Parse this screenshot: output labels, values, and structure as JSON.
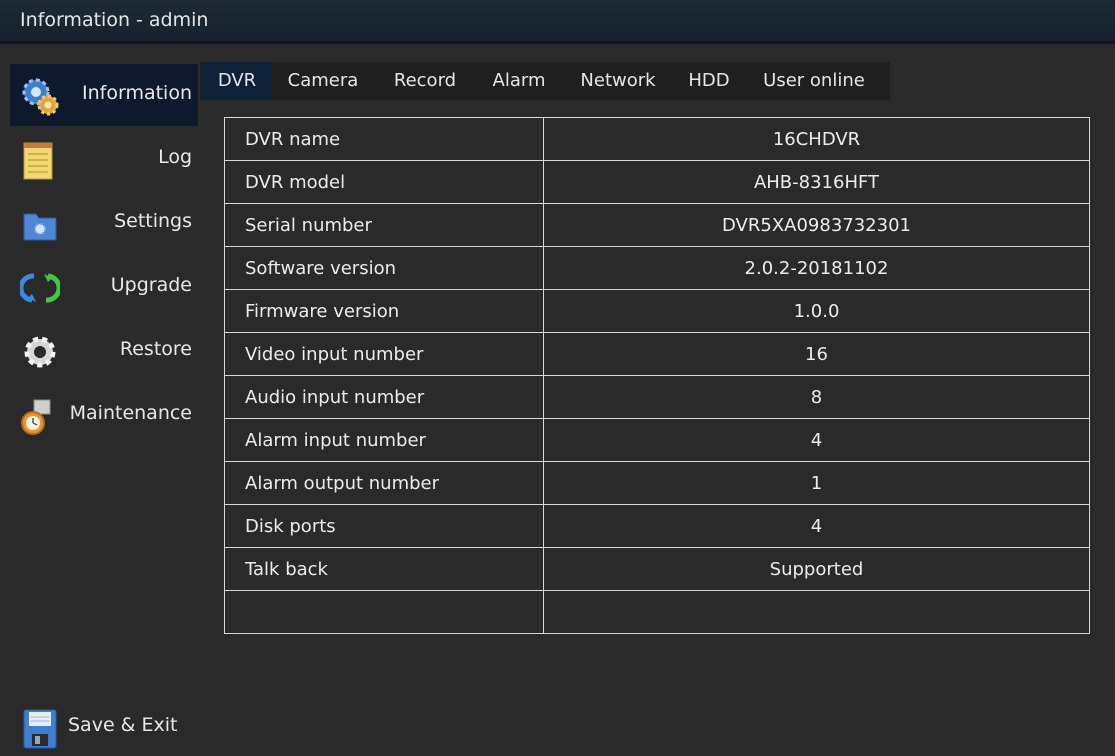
{
  "window": {
    "title": "Information - admin"
  },
  "sidebar": {
    "items": [
      {
        "label": "Information",
        "icon": "gears-icon",
        "active": true
      },
      {
        "label": "Log",
        "icon": "notepad-icon",
        "active": false
      },
      {
        "label": "Settings",
        "icon": "settings-folder-icon",
        "active": false
      },
      {
        "label": "Upgrade",
        "icon": "refresh-arrows-icon",
        "active": false
      },
      {
        "label": "Restore",
        "icon": "gear-icon",
        "active": false
      },
      {
        "label": "Maintenance",
        "icon": "clock-calendar-icon",
        "active": false
      }
    ],
    "save_exit": {
      "label": "Save & Exit",
      "icon": "floppy-disk-icon"
    }
  },
  "tabs": [
    {
      "label": "DVR",
      "active": true
    },
    {
      "label": "Camera",
      "active": false
    },
    {
      "label": "Record",
      "active": false
    },
    {
      "label": "Alarm",
      "active": false
    },
    {
      "label": "Network",
      "active": false
    },
    {
      "label": "HDD",
      "active": false
    },
    {
      "label": "User online",
      "active": false
    }
  ],
  "info_table": {
    "rows": [
      {
        "key": "DVR name",
        "value": "16CHDVR"
      },
      {
        "key": "DVR model",
        "value": "AHB-8316HFT"
      },
      {
        "key": "Serial number",
        "value": "DVR5XA0983732301"
      },
      {
        "key": "Software version",
        "value": "2.0.2-20181102"
      },
      {
        "key": "Firmware version",
        "value": "1.0.0"
      },
      {
        "key": "Video input number",
        "value": "16"
      },
      {
        "key": "Audio input number",
        "value": "8"
      },
      {
        "key": "Alarm input number",
        "value": "4"
      },
      {
        "key": "Alarm output number",
        "value": "1"
      },
      {
        "key": "Disk ports",
        "value": "4"
      },
      {
        "key": "Talk back",
        "value": "Supported"
      },
      {
        "key": "",
        "value": ""
      }
    ]
  },
  "colors": {
    "active_bg": "#0d1a2e",
    "tab_active_bg": "#0f2039",
    "background": "#2a2a2a"
  }
}
